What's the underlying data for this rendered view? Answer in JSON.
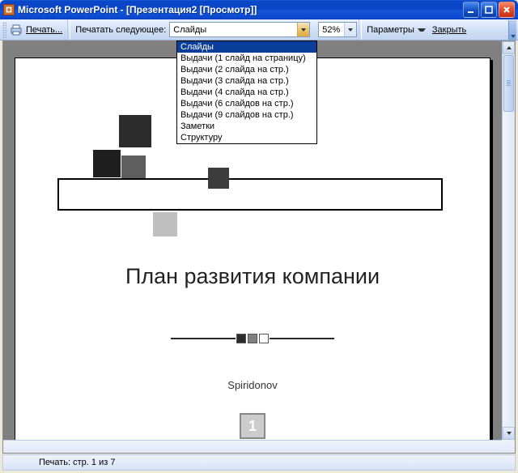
{
  "title": "Microsoft PowerPoint - [Презентация2 [Просмотр]]",
  "toolbar": {
    "print": "Печать...",
    "print_what_label": "Печатать следующее:",
    "print_what_value": "Слайды",
    "zoom": "52%",
    "options": "Параметры",
    "close": "Закрыть"
  },
  "dropdown_options": [
    "Слайды",
    "Выдачи (1 слайд на страницу)",
    "Выдачи (2 слайда на стр.)",
    "Выдачи (3 слайда на стр.)",
    "Выдачи (4 слайда на стр.)",
    "Выдачи (6 слайдов на стр.)",
    "Выдачи (9 слайдов на стр.)",
    "Заметки",
    "Структуру"
  ],
  "slide": {
    "title": "План развития компании",
    "author": "Spiridonov",
    "page_number": "1"
  },
  "status": "Печать: стр. 1 из 7"
}
